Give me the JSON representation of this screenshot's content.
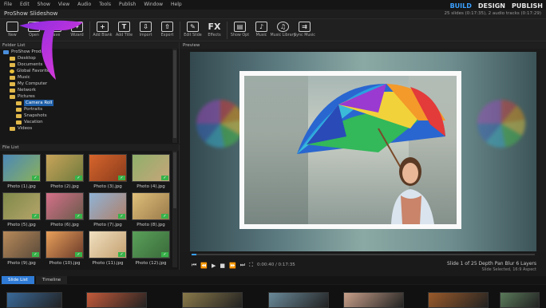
{
  "menu": [
    "File",
    "Edit",
    "Show",
    "View",
    "Audio",
    "Tools",
    "Publish",
    "Window",
    "Help"
  ],
  "modes": [
    {
      "label": "BUILD",
      "active": true
    },
    {
      "label": "DESIGN",
      "active": false
    },
    {
      "label": "PUBLISH",
      "active": false
    }
  ],
  "app_title": "ProShow Slideshow",
  "project_info": "25 slides (0:17:35), 2 audio tracks (0:17:29)",
  "toolbar": [
    {
      "label": "New",
      "icon": "new-icon"
    },
    {
      "label": "Open",
      "icon": "open-icon"
    },
    {
      "label": "Save",
      "icon": "save-icon"
    },
    {
      "label": "Wizard",
      "icon": "wizard-icon"
    },
    {
      "label": "Add Blank",
      "icon": "add-blank-icon"
    },
    {
      "label": "Add Title",
      "icon": "add-title-icon"
    },
    {
      "label": "Import",
      "icon": "import-icon"
    },
    {
      "label": "Export",
      "icon": "export-icon"
    },
    {
      "label": "Edit Slide",
      "icon": "edit-slide-icon"
    },
    {
      "label": "Effects",
      "icon": "fx-icon"
    },
    {
      "label": "Show Opt",
      "icon": "show-options-icon"
    },
    {
      "label": "Music",
      "icon": "music-icon"
    },
    {
      "label": "Music Library",
      "icon": "music-library-icon"
    },
    {
      "label": "Sync Music",
      "icon": "sync-music-icon"
    }
  ],
  "folders": {
    "header": "Folder List",
    "items": [
      {
        "label": "ProShow Producer",
        "depth": 0,
        "icon": "computer-icon"
      },
      {
        "label": "Desktop",
        "depth": 1,
        "icon": "folder-icon"
      },
      {
        "label": "Documents",
        "depth": 1,
        "icon": "folder-icon"
      },
      {
        "label": "Global Favorites",
        "depth": 1,
        "icon": "star-icon"
      },
      {
        "label": "Music",
        "depth": 1,
        "icon": "folder-icon"
      },
      {
        "label": "My Computer",
        "depth": 1,
        "icon": "folder-icon"
      },
      {
        "label": "Network",
        "depth": 1,
        "icon": "folder-icon"
      },
      {
        "label": "Pictures",
        "depth": 1,
        "icon": "folder-icon"
      },
      {
        "label": "Camera Roll",
        "depth": 2,
        "icon": "folder-icon",
        "selected": true
      },
      {
        "label": "Portraits",
        "depth": 2,
        "icon": "folder-icon"
      },
      {
        "label": "Snapshots",
        "depth": 2,
        "icon": "folder-icon"
      },
      {
        "label": "Vacation",
        "depth": 2,
        "icon": "folder-icon"
      },
      {
        "label": "Videos",
        "depth": 1,
        "icon": "folder-icon"
      }
    ]
  },
  "files": {
    "header": "File List",
    "items": [
      {
        "label": "Photo (1).jpg",
        "c1": "#4a88b8",
        "c2": "#8bb15a"
      },
      {
        "label": "Photo (2).jpg",
        "c1": "#c9a45a",
        "c2": "#6e7a3c"
      },
      {
        "label": "Photo (3).jpg",
        "c1": "#d6652c",
        "c2": "#8a3b1c"
      },
      {
        "label": "Photo (4).jpg",
        "c1": "#8fb06a",
        "c2": "#c7a57a"
      },
      {
        "label": "Photo (5).jpg",
        "c1": "#7f8a4a",
        "c2": "#b5a46a"
      },
      {
        "label": "Photo (6).jpg",
        "c1": "#d5708a",
        "c2": "#6a5a4a"
      },
      {
        "label": "Photo (7).jpg",
        "c1": "#8fb3d6",
        "c2": "#b0806a"
      },
      {
        "label": "Photo (8).jpg",
        "c1": "#e0c07a",
        "c2": "#9a7a4a"
      },
      {
        "label": "Photo (9).jpg",
        "c1": "#b88a5a",
        "c2": "#5a4a3a"
      },
      {
        "label": "Photo (10).jpg",
        "c1": "#e9a05a",
        "c2": "#6a3a2a"
      },
      {
        "label": "Photo (11).jpg",
        "c1": "#f0e0c0",
        "c2": "#c4a070"
      },
      {
        "label": "Photo (12).jpg",
        "c1": "#5aa05a",
        "c2": "#3a6a3a"
      }
    ]
  },
  "preview": {
    "header": "Preview",
    "timecode": "0:00:40 / 0:17:35",
    "progress": 0.015,
    "slide_info": "Slide 1 of 25   Depth Pan Blur   6 Layers",
    "slide_sub": "Slide Selected, 16:9 Aspect"
  },
  "bottom_tabs": [
    {
      "label": "Slide List",
      "active": true
    },
    {
      "label": "Timeline",
      "active": false
    }
  ],
  "strip_colors": [
    "#3a6a9a",
    "#c45a3a",
    "#8a7a4a",
    "#6a8a9a",
    "#c9a08a",
    "#9a5a2a",
    "#5a7a5a"
  ],
  "colors": {
    "accent": "#3aa0ff",
    "logo_start": "#8a2be2",
    "logo_end": "#e83cd6"
  }
}
